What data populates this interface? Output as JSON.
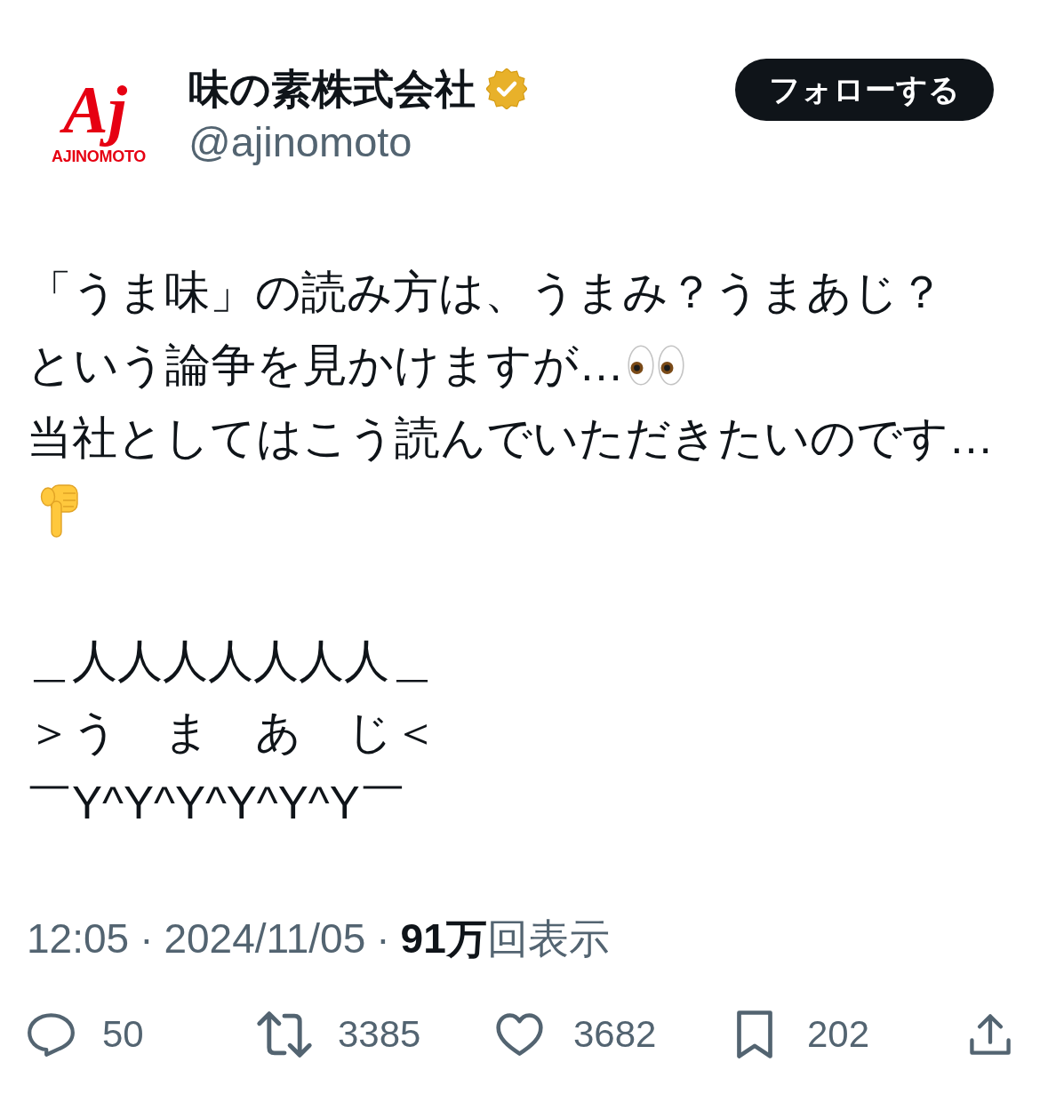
{
  "account": {
    "logo": {
      "mark": "Aj",
      "wordmark": "AJINOMOTO"
    },
    "display_name": "味の素株式会社",
    "verified": true,
    "handle": "@ajinomoto"
  },
  "follow_button": {
    "label": "フォローする"
  },
  "post": {
    "lines": [
      {
        "kind": "text",
        "text": "「うま味」の読み方は、うまみ？うまあじ？"
      },
      {
        "kind": "eyes",
        "text": "という論争を見かけますが…"
      },
      {
        "kind": "text",
        "text": "当社としてはこう読んでいただきたいのです…"
      },
      {
        "kind": "hand"
      }
    ],
    "art_lines": [
      "＿人人人人人人人＿",
      "＞う　ま　あ　じ＜",
      "￣Y^Y^Y^Y^Y^Y￣"
    ]
  },
  "meta": {
    "time": "12:05",
    "separator_1": "·",
    "date": "2024/11/05",
    "separator_2": "·",
    "views": "**91万**回表示"
  },
  "actions": [
    {
      "kind": "reply",
      "count": "50"
    },
    {
      "kind": "repost",
      "count": "3385"
    },
    {
      "kind": "like",
      "count": "3682"
    },
    {
      "kind": "bookmark",
      "count": "202"
    },
    {
      "kind": "share"
    }
  ]
}
